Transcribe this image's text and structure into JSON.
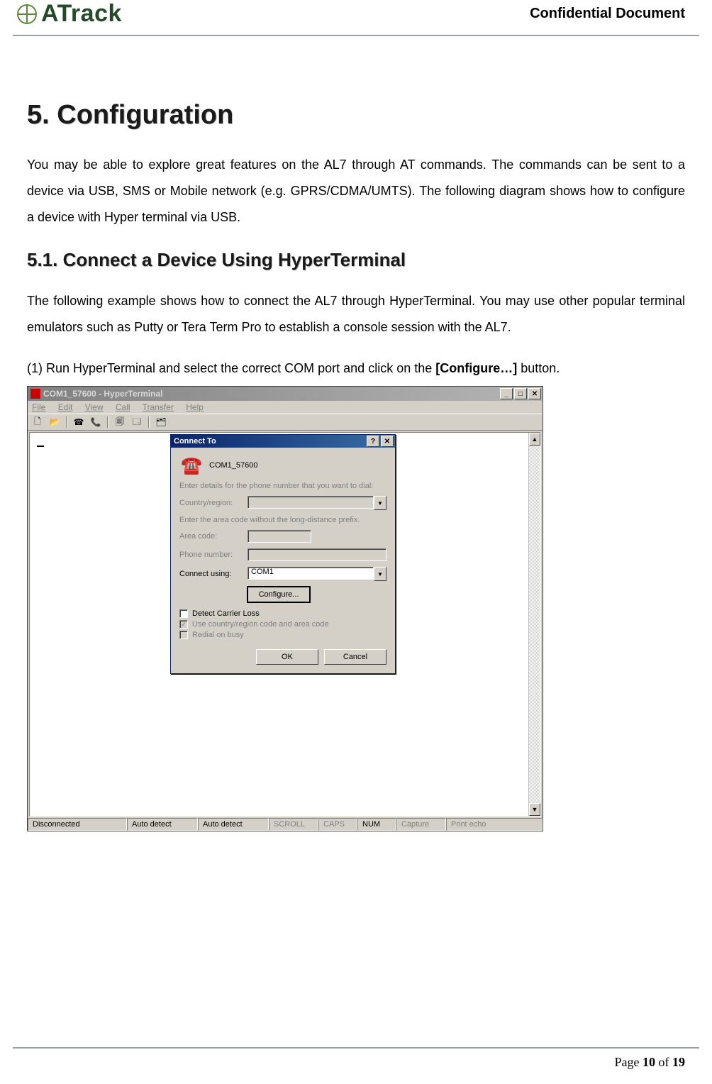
{
  "header": {
    "brand": "ATrack",
    "confidential": "Confidential  Document"
  },
  "section": {
    "h1": "5. Configuration",
    "p1": "You may be able to explore great features on the AL7 through AT commands. The commands can be sent to a device via USB, SMS or Mobile network (e.g. GPRS/CDMA/UMTS). The following diagram shows how to configure a device with Hyper terminal via USB.",
    "h2": "5.1. Connect a Device Using HyperTerminal",
    "p2": "The following example shows how to connect the AL7 through HyperTerminal. You may use other popular terminal emulators such as Putty or Tera Term Pro to establish a console session with the AL7.",
    "step1_prefix": "(1)  Run HyperTerminal and select the correct COM port and click on the ",
    "step1_bold": "[Configure…]",
    "step1_suffix": " button."
  },
  "hyperterm": {
    "title": "COM1_57600 - HyperTerminal",
    "menu": [
      "File",
      "Edit",
      "View",
      "Call",
      "Transfer",
      "Help"
    ],
    "status": {
      "conn": "Disconnected",
      "auto1": "Auto detect",
      "auto2": "Auto detect",
      "scroll": "SCROLL",
      "caps": "CAPS",
      "num": "NUM",
      "capture": "Capture",
      "print": "Print echo"
    }
  },
  "dialog": {
    "title": "Connect To",
    "conn_name": "COM1_57600",
    "enter_details": "Enter details for the phone number that you want to dial:",
    "country_label": "Country/region:",
    "enter_area": "Enter the area code without the long-distance prefix.",
    "area_label": "Area code:",
    "phone_label": "Phone number:",
    "connect_label": "Connect using:",
    "connect_value": "COM1",
    "configure": "Configure...",
    "chk_detect": "Detect Carrier Loss",
    "chk_use": "Use country/region code and area code",
    "chk_redial": "Redial on busy",
    "ok": "OK",
    "cancel": "Cancel"
  },
  "footer": {
    "pre": "Page ",
    "cur": "10",
    "mid": " of ",
    "tot": "19"
  }
}
